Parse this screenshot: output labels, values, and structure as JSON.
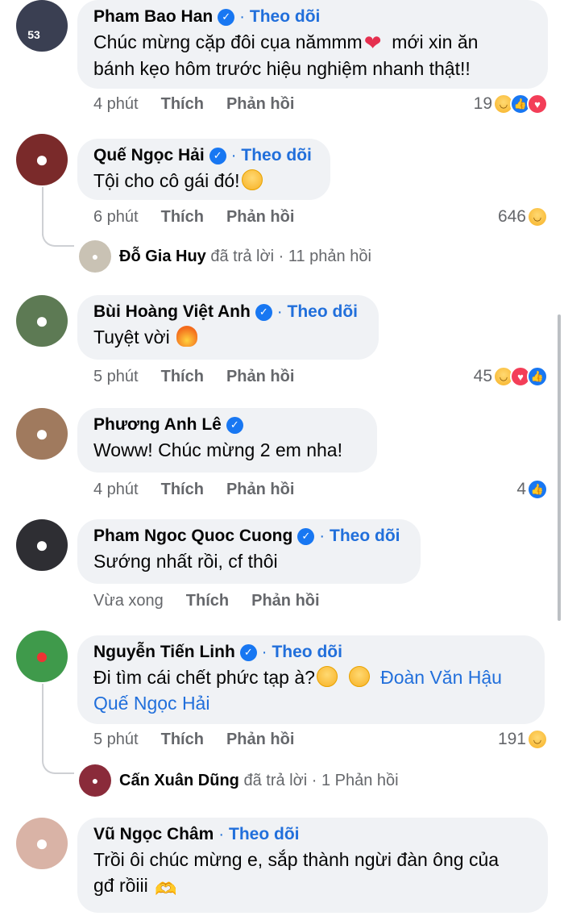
{
  "ui": {
    "follow_label": "Theo dõi",
    "like_label": "Thích",
    "reply_label": "Phản hồi",
    "separator": "·"
  },
  "comments": [
    {
      "author": "Pham Bao Han",
      "avatar_badge": "53",
      "text": "Chúc mừng cặp đôi cụa nămmm",
      "text_2": "mới xin ăn",
      "text_line2": "bánh kẹo hôm trước hiệu nghiệm nhanh thật!!",
      "time": "4 phút",
      "reaction_count": "19",
      "reactions": [
        "haha",
        "like",
        "love"
      ]
    },
    {
      "author": "Quế Ngọc Hải",
      "text": "Tội cho cô gái đó!",
      "time": "6 phút",
      "reaction_count": "646",
      "reactions": [
        "haha"
      ],
      "reply_summary": {
        "name": "Đỗ Gia Huy",
        "action": "đã trả lời",
        "count": "11 phản hồi"
      }
    },
    {
      "author": "Bùi Hoàng Việt Anh",
      "text": "Tuyệt vời",
      "time": "5 phút",
      "reaction_count": "45",
      "reactions": [
        "haha",
        "love",
        "like"
      ]
    },
    {
      "author": "Phương Anh Lê",
      "text": "Woww! Chúc mừng 2 em nha!",
      "time": "4 phút",
      "reaction_count": "4",
      "reactions": [
        "like"
      ]
    },
    {
      "author": "Pham Ngoc Quoc Cuong",
      "text": "Sướng nhất rồi, cf thôi",
      "time": "Vừa xong"
    },
    {
      "author": "Nguyễn Tiến Linh",
      "text": "Đi tìm cái chết phức tạp à?",
      "mention_1": "Đoàn Văn Hậu",
      "mention_2": "Quế Ngọc Hải",
      "time": "5 phút",
      "reaction_count": "191",
      "reactions": [
        "haha"
      ],
      "reply_summary": {
        "name": "Cấn Xuân Dũng",
        "action": "đã trả lời",
        "count": "1 Phản hồi"
      }
    },
    {
      "author": "Vũ Ngọc Châm",
      "text": "Trồi ôi chúc mừng e, sắp thành ngừi đàn ông của",
      "text_line2": "gđ rồiii"
    }
  ],
  "colors": {
    "bubble": "#f0f2f5",
    "link": "#216fdb",
    "meta": "#65676b",
    "verified": "#1877f2"
  }
}
